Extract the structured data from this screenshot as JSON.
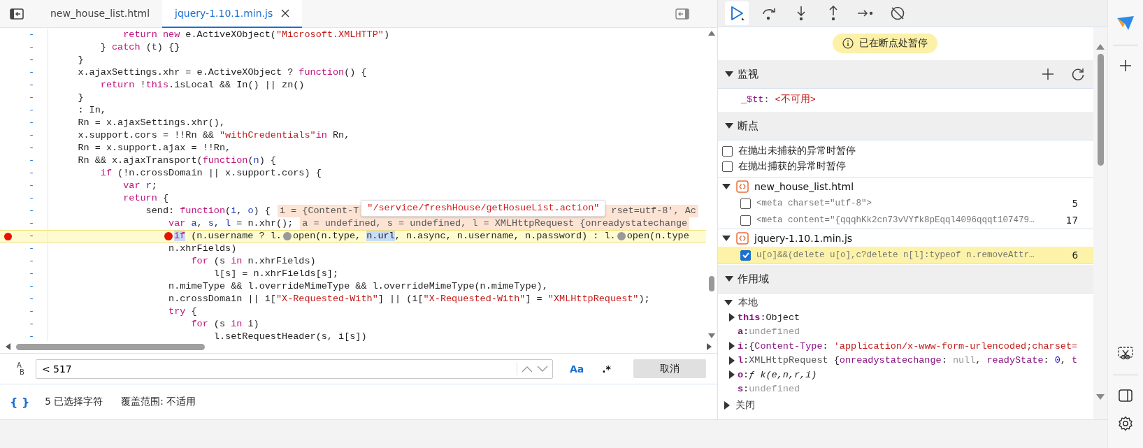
{
  "editor": {
    "tabs": [
      {
        "label": "new_house_list.html",
        "selected": false,
        "closable": false
      },
      {
        "label": "jquery-1.10.1.min.js",
        "selected": true,
        "closable": true
      }
    ],
    "lines": [
      {
        "marker": "-",
        "breakpoint": false,
        "paused": false,
        "code": [
          {
            "kind": "keyword",
            "text": "            return"
          },
          {
            "kind": "keyword",
            "text": " new"
          },
          {
            "kind": "plain",
            "text": " e.ActiveXObject("
          },
          {
            "kind": "string",
            "text": "\"Microsoft.XMLHTTP\""
          },
          {
            "kind": "plain",
            "text": ")"
          }
        ]
      },
      {
        "marker": "-",
        "breakpoint": false,
        "paused": false,
        "code": [
          {
            "kind": "plain",
            "text": "        } "
          },
          {
            "kind": "keyword",
            "text": "catch"
          },
          {
            "kind": "plain",
            "text": " ("
          },
          {
            "kind": "variable",
            "text": "t"
          },
          {
            "kind": "plain",
            "text": ") {}"
          }
        ]
      },
      {
        "marker": "-",
        "breakpoint": false,
        "paused": false,
        "code": [
          {
            "kind": "plain",
            "text": "    }"
          }
        ]
      },
      {
        "marker": "-",
        "breakpoint": false,
        "paused": false,
        "code": [
          {
            "kind": "plain",
            "text": "    x.ajaxSettings.xhr = e.ActiveXObject ? "
          },
          {
            "kind": "keyword",
            "text": "function"
          },
          {
            "kind": "plain",
            "text": "() {"
          }
        ]
      },
      {
        "marker": "-",
        "breakpoint": false,
        "paused": false,
        "code": [
          {
            "kind": "keyword",
            "text": "        return"
          },
          {
            "kind": "plain",
            "text": " !"
          },
          {
            "kind": "keyword",
            "text": "this"
          },
          {
            "kind": "plain",
            "text": ".isLocal && In() || zn()"
          }
        ]
      },
      {
        "marker": "-",
        "breakpoint": false,
        "paused": false,
        "code": [
          {
            "kind": "plain",
            "text": "    }"
          }
        ]
      },
      {
        "marker": "-",
        "breakpoint": false,
        "paused": false,
        "code": [
          {
            "kind": "plain",
            "text": "    : In,"
          }
        ]
      },
      {
        "marker": "-",
        "breakpoint": false,
        "paused": false,
        "code": [
          {
            "kind": "plain",
            "text": "    Rn = x.ajaxSettings.xhr(),"
          }
        ]
      },
      {
        "marker": "-",
        "breakpoint": false,
        "paused": false,
        "code": [
          {
            "kind": "plain",
            "text": "    x.support.cors = !!Rn && "
          },
          {
            "kind": "string",
            "text": "\"withCredentials\""
          },
          {
            "kind": "keyword",
            "text": "in"
          },
          {
            "kind": "plain",
            "text": " Rn,"
          }
        ]
      },
      {
        "marker": "-",
        "breakpoint": false,
        "paused": false,
        "code": [
          {
            "kind": "plain",
            "text": "    Rn = x.support.ajax = !!Rn,"
          }
        ]
      },
      {
        "marker": "-",
        "breakpoint": false,
        "paused": false,
        "code": [
          {
            "kind": "plain",
            "text": "    Rn && x.ajaxTransport("
          },
          {
            "kind": "keyword",
            "text": "function"
          },
          {
            "kind": "plain",
            "text": "("
          },
          {
            "kind": "variable",
            "text": "n"
          },
          {
            "kind": "plain",
            "text": ") {"
          }
        ]
      },
      {
        "marker": "-",
        "breakpoint": false,
        "paused": false,
        "code": [
          {
            "kind": "keyword",
            "text": "        if"
          },
          {
            "kind": "plain",
            "text": " (!n.crossDomain || x.support.cors) {"
          }
        ]
      },
      {
        "marker": "-",
        "breakpoint": false,
        "paused": false,
        "code": [
          {
            "kind": "keyword",
            "text": "            var"
          },
          {
            "kind": "variable",
            "text": " r"
          },
          {
            "kind": "plain",
            "text": ";"
          }
        ]
      },
      {
        "marker": "-",
        "breakpoint": false,
        "paused": false,
        "code": [
          {
            "kind": "keyword",
            "text": "            return"
          },
          {
            "kind": "plain",
            "text": " {"
          }
        ]
      },
      {
        "marker": "-",
        "breakpoint": false,
        "paused": false,
        "code": [
          {
            "kind": "plain",
            "text": "                send: "
          },
          {
            "kind": "keyword",
            "text": "function"
          },
          {
            "kind": "plain",
            "text": "("
          },
          {
            "kind": "variable",
            "text": "i"
          },
          {
            "kind": "plain",
            "text": ", "
          },
          {
            "kind": "variable",
            "text": "o"
          },
          {
            "kind": "plain",
            "text": ") {"
          }
        ],
        "inline": [
          "i = {Content-T",
          "rset=utf-8', Ac"
        ],
        "tooltip": "\"/service/freshHouse/getHosueList.action\""
      },
      {
        "marker": "-",
        "breakpoint": false,
        "paused": false,
        "code": [
          {
            "kind": "keyword",
            "text": "                    var"
          },
          {
            "kind": "variable",
            "text": " a"
          },
          {
            "kind": "plain",
            "text": ", "
          },
          {
            "kind": "variable",
            "text": "s"
          },
          {
            "kind": "plain",
            "text": ", "
          },
          {
            "kind": "variable",
            "text": "l"
          },
          {
            "kind": "plain",
            "text": " = n.xhr();"
          }
        ],
        "inline": [
          "a = undefined, s = undefined, l = XMLHttpRequest {onreadystatechange"
        ]
      },
      {
        "marker": "-",
        "breakpoint": true,
        "paused": true,
        "code": [
          {
            "kind": "selected-keyword",
            "text": "                   if",
            "marker_active": true
          },
          {
            "kind": "plain",
            "text": " (n.username ? l."
          },
          {
            "kind": "plain",
            "text": "open(n.type, ",
            "marker_active": false
          },
          {
            "kind": "selected-plain",
            "text": "n.url"
          },
          {
            "kind": "plain",
            "text": ", n.async, n.username, n.password) : l."
          },
          {
            "kind": "plain",
            "text": "open(n.type",
            "marker_active": false
          }
        ]
      },
      {
        "marker": "-",
        "breakpoint": false,
        "paused": false,
        "code": [
          {
            "kind": "plain",
            "text": "                    n.xhrFields)"
          }
        ]
      },
      {
        "marker": "-",
        "breakpoint": false,
        "paused": false,
        "code": [
          {
            "kind": "keyword",
            "text": "                        for"
          },
          {
            "kind": "plain",
            "text": " (s "
          },
          {
            "kind": "keyword",
            "text": "in"
          },
          {
            "kind": "plain",
            "text": " n.xhrFields)"
          }
        ]
      },
      {
        "marker": "-",
        "breakpoint": false,
        "paused": false,
        "code": [
          {
            "kind": "plain",
            "text": "                            l[s] = n.xhrFields[s];"
          }
        ]
      },
      {
        "marker": "-",
        "breakpoint": false,
        "paused": false,
        "code": [
          {
            "kind": "plain",
            "text": "                    n.mimeType && l.overrideMimeType && l.overrideMimeType(n.mimeType),"
          }
        ]
      },
      {
        "marker": "-",
        "breakpoint": false,
        "paused": false,
        "code": [
          {
            "kind": "plain",
            "text": "                    n.crossDomain || i["
          },
          {
            "kind": "string",
            "text": "\"X-Requested-With\""
          },
          {
            "kind": "plain",
            "text": "] || (i["
          },
          {
            "kind": "string",
            "text": "\"X-Requested-With\""
          },
          {
            "kind": "plain",
            "text": "] = "
          },
          {
            "kind": "string",
            "text": "\"XMLHttpRequest\""
          },
          {
            "kind": "plain",
            "text": ");"
          }
        ]
      },
      {
        "marker": "-",
        "breakpoint": false,
        "paused": false,
        "code": [
          {
            "kind": "keyword",
            "text": "                    try"
          },
          {
            "kind": "plain",
            "text": " {"
          }
        ]
      },
      {
        "marker": "-",
        "breakpoint": false,
        "paused": false,
        "code": [
          {
            "kind": "keyword",
            "text": "                        for"
          },
          {
            "kind": "plain",
            "text": " (s "
          },
          {
            "kind": "keyword",
            "text": "in"
          },
          {
            "kind": "plain",
            "text": " i)"
          }
        ]
      },
      {
        "marker": "-",
        "breakpoint": false,
        "paused": false,
        "code": [
          {
            "kind": "plain",
            "text": "                            l.setRequestHeader(s, i[s])"
          }
        ]
      }
    ],
    "replace_toggle": [
      "A",
      "B"
    ],
    "search": {
      "value": "< 517"
    },
    "search_options": [
      "Aa",
      ".*"
    ],
    "cancel": "取消",
    "format_icon": "{ }",
    "status": {
      "selection": "5 已选择字符",
      "coverage": "覆盖范围: 不适用"
    }
  },
  "debugger": {
    "banner": "已在断点处暂停",
    "watch": {
      "title": "监视",
      "expanded": true,
      "items": [
        {
          "name": "_$tt",
          "separator": ":",
          "value": "<不可用>"
        }
      ]
    },
    "breakpoints": {
      "title": "断点",
      "expanded": true,
      "exceptions": [
        {
          "label": "在抛出未捕获的异常时暂停",
          "checked": false
        },
        {
          "label": "在抛出捕获的异常时暂停",
          "checked": false
        }
      ],
      "files": [
        {
          "name": "new_house_list.html",
          "expanded": true,
          "items": [
            {
              "code": "<meta charset=\"utf-8\">",
              "line": "5",
              "checked": false,
              "paused": false
            },
            {
              "code": "<meta content=\"{qqqhKk2cn73vVYfk8pEqql4096qqqt107479…",
              "line": "17",
              "checked": false,
              "paused": false
            }
          ]
        },
        {
          "name": "jquery-1.10.1.min.js",
          "expanded": true,
          "items": [
            {
              "code": "u[o]&&(delete u[o],c?delete n[l]:typeof n.removeAttr…",
              "line": "6",
              "checked": true,
              "paused": true
            }
          ]
        }
      ]
    },
    "scope": {
      "title": "作用域",
      "expanded": true,
      "groups": [
        {
          "title": "本地",
          "expanded": true,
          "vars": [
            {
              "name": "this",
              "separator": ":",
              "expandable": true,
              "value": [
                {
                  "kind": "plain",
                  "text": "Object"
                }
              ]
            },
            {
              "name": "a",
              "separator": ":",
              "expandable": false,
              "value": [
                {
                  "kind": "undefined",
                  "text": "undefined"
                }
              ]
            },
            {
              "name": "i",
              "separator": ":",
              "expandable": true,
              "value": [
                {
                  "kind": "plain",
                  "text": "{"
                },
                {
                  "kind": "key",
                  "text": "Content-Type"
                },
                {
                  "kind": "plain",
                  "text": ":"
                },
                {
                  "kind": "string",
                  "text": " 'application/x-www-form-urlencoded;charset="
                }
              ]
            },
            {
              "name": "l",
              "separator": ":",
              "expandable": true,
              "value": [
                {
                  "kind": "class",
                  "text": "XMLHttpRequest"
                },
                {
                  "kind": "plain",
                  "text": " {"
                },
                {
                  "kind": "key",
                  "text": "onreadystatechange"
                },
                {
                  "kind": "plain",
                  "text": ":"
                },
                {
                  "kind": "undefined",
                  "text": " null"
                },
                {
                  "kind": "plain",
                  "text": ","
                },
                {
                  "kind": "key",
                  "text": " readyState"
                },
                {
                  "kind": "plain",
                  "text": ":"
                },
                {
                  "kind": "number",
                  "text": " 0"
                },
                {
                  "kind": "plain",
                  "text": ","
                },
                {
                  "kind": "key",
                  "text": " t"
                }
              ]
            },
            {
              "name": "o",
              "separator": ":",
              "expandable": true,
              "value": [
                {
                  "kind": "function",
                  "text": "ƒ k(e,n,r,i)"
                }
              ]
            },
            {
              "name": "s",
              "separator": ":",
              "expandable": false,
              "value": [
                {
                  "kind": "undefined",
                  "text": "undefined"
                }
              ]
            }
          ]
        },
        {
          "title": "关闭",
          "expanded": false
        }
      ]
    }
  }
}
